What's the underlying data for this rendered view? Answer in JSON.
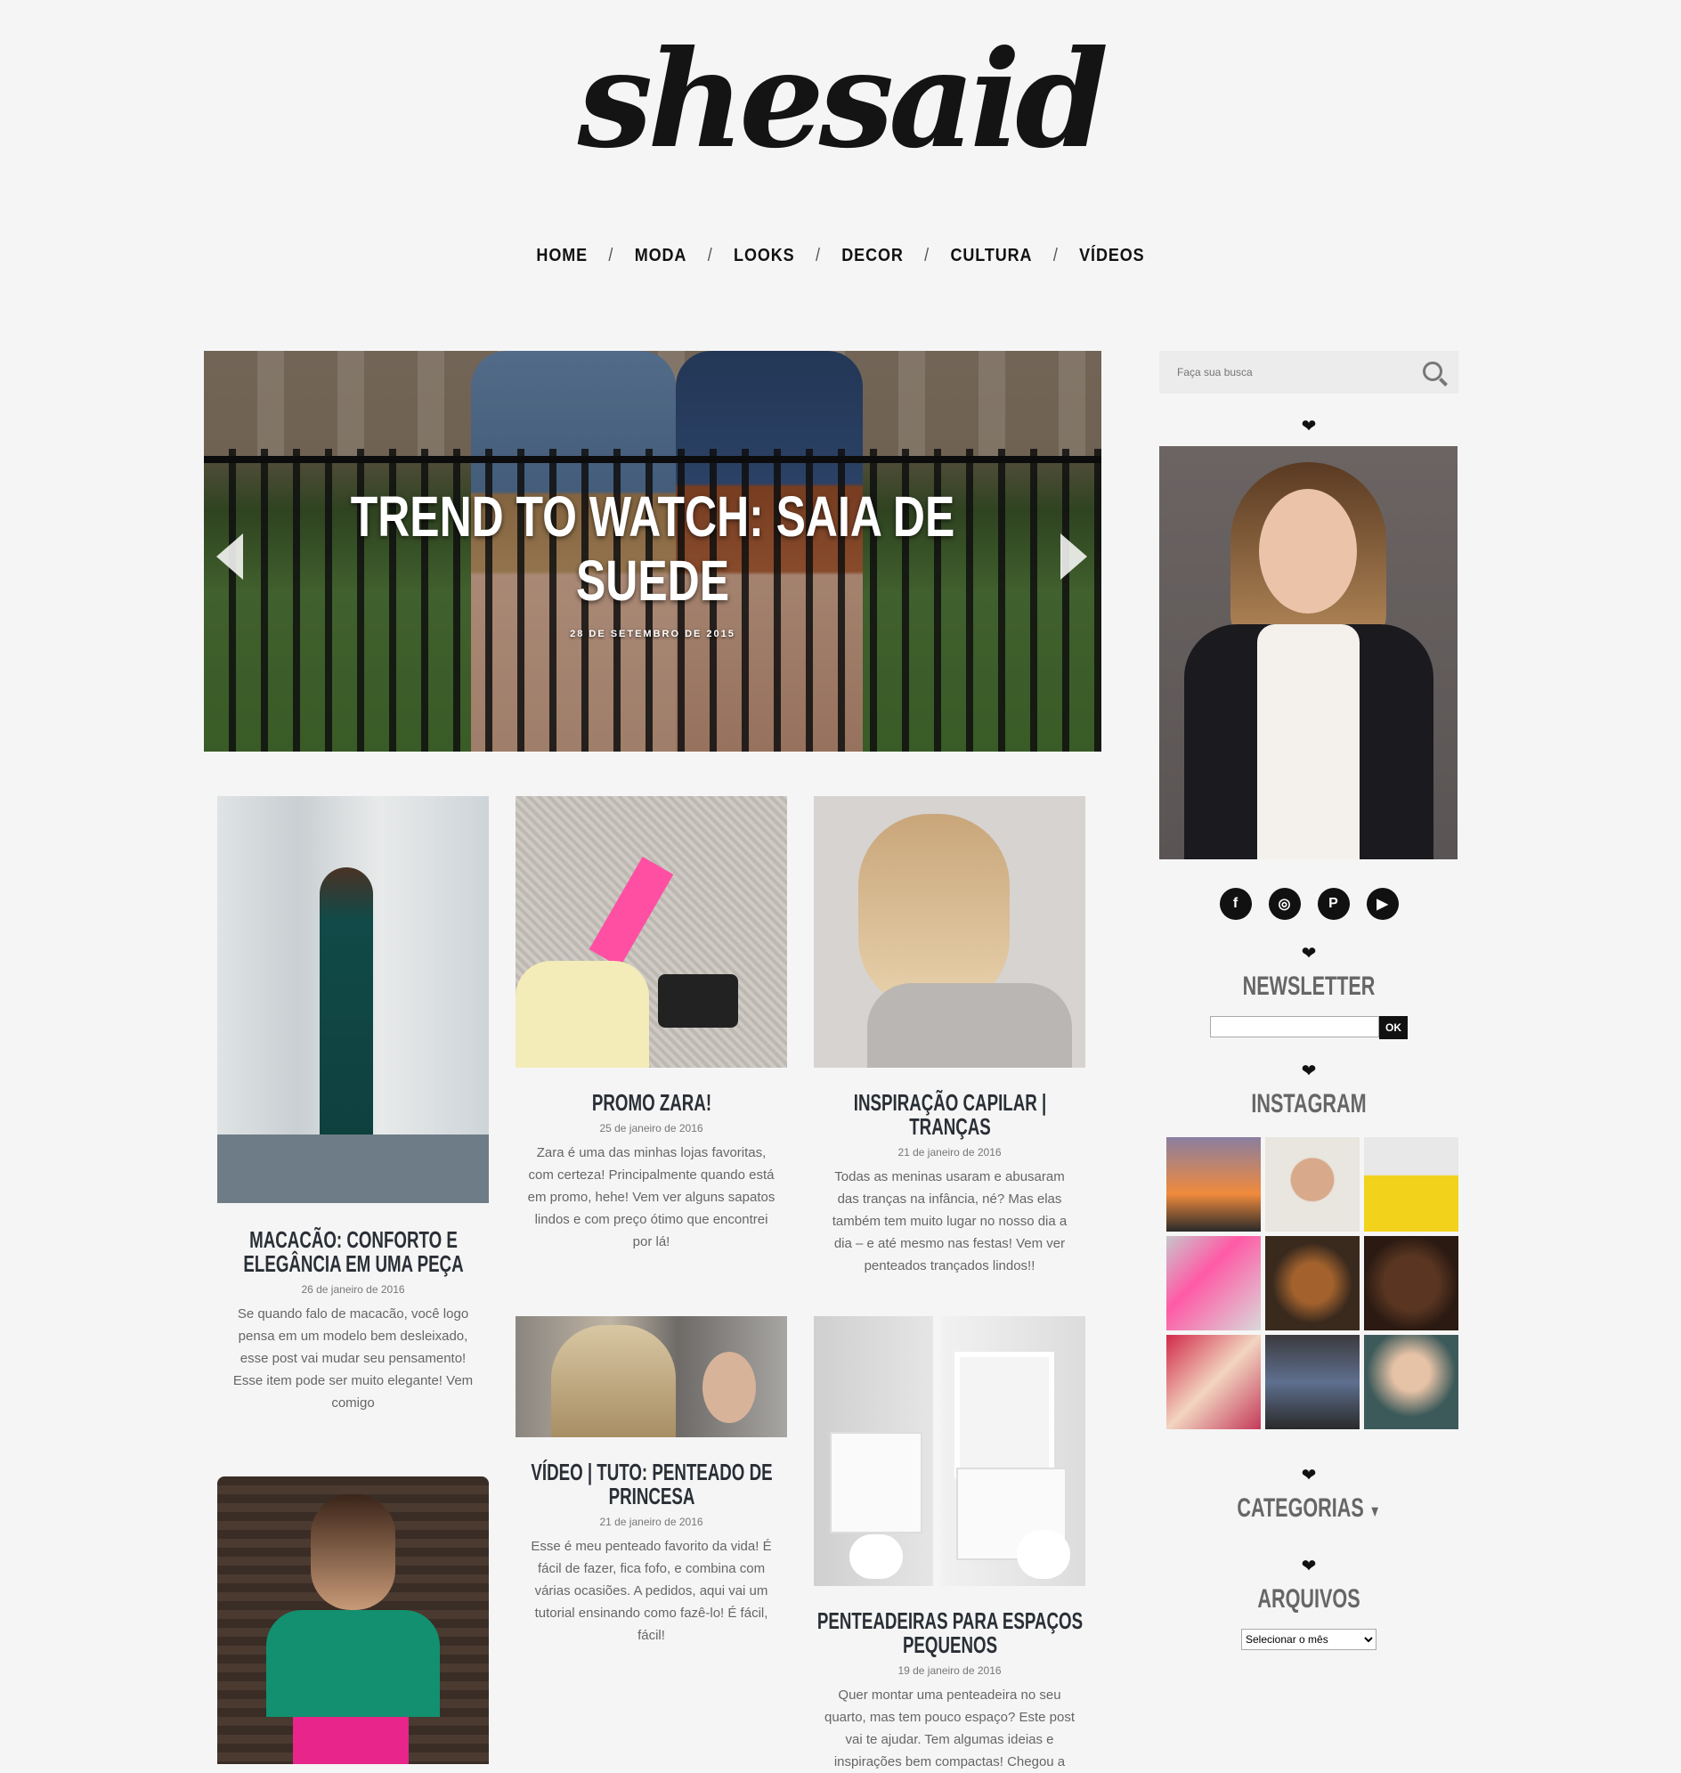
{
  "header": {
    "logo": "shesaid"
  },
  "nav": [
    "HOME",
    "MODA",
    "LOOKS",
    "DECOR",
    "CULTURA",
    "VÍDEOS"
  ],
  "slider": {
    "title": "TREND TO WATCH: SAIA DE SUEDE",
    "date": "28 DE SETEMBRO DE 2015"
  },
  "posts": [
    {
      "title": "MACACÃO: CONFORTO E ELEGÂNCIA EM UMA PEÇA",
      "date": "26 de janeiro de 2016",
      "excerpt": "Se quando falo de macacão, você logo pensa em um modelo bem desleixado, esse post vai mudar seu pensamento! Esse item pode ser muito elegante! Vem comigo"
    },
    {
      "title": "PROMO ZARA!",
      "date": "25 de janeiro de 2016",
      "excerpt": "Zara é uma das minhas lojas favoritas, com certeza! Principalmente quando está em promo, hehe! Vem ver alguns sapatos lindos e com preço ótimo que encontrei por lá!"
    },
    {
      "title": "INSPIRAÇÃO CAPILAR | TRANÇAS",
      "date": "21 de janeiro de 2016",
      "excerpt": "Todas as meninas usaram e abusaram das tranças na infância, né? Mas elas também tem muito lugar no nosso dia a dia – e até mesmo nas festas! Vem ver penteados trançados lindos!!"
    },
    {
      "title": "VÍDEO | TUTO: PENTEADO DE PRINCESA",
      "date": "21 de janeiro de 2016",
      "excerpt": "Esse é meu penteado favorito da vida! É fácil de fazer, fica fofo, e combina com várias ocasiões. A pedidos, aqui vai um tutorial ensinando como fazê-lo! É fácil, fácil!"
    },
    {
      "title": "PENTEADEIRAS PARA ESPAÇOS PEQUENOS",
      "date": "19 de janeiro de 2016",
      "excerpt": "Quer montar uma penteadeira no seu quarto, mas tem pouco espaço? Este post vai te ajudar. Tem algumas ideias e inspirações bem compactas! Chegou a"
    }
  ],
  "sidebar": {
    "search_placeholder": "Faça sua busca",
    "heart": "❤",
    "social_icons": [
      "facebook-icon",
      "instagram-icon",
      "pinterest-icon",
      "youtube-icon"
    ],
    "newsletter_title": "NEWSLETTER",
    "newsletter_button": "OK",
    "instagram_title": "INSTAGRAM",
    "categories_title": "CATEGORIAS",
    "archives_title": "ARQUIVOS",
    "archives_select": "Selecionar o mês"
  },
  "colors": {
    "background": "#f5f5f5",
    "heading": "#2a2f36",
    "widget_title": "#666666"
  }
}
